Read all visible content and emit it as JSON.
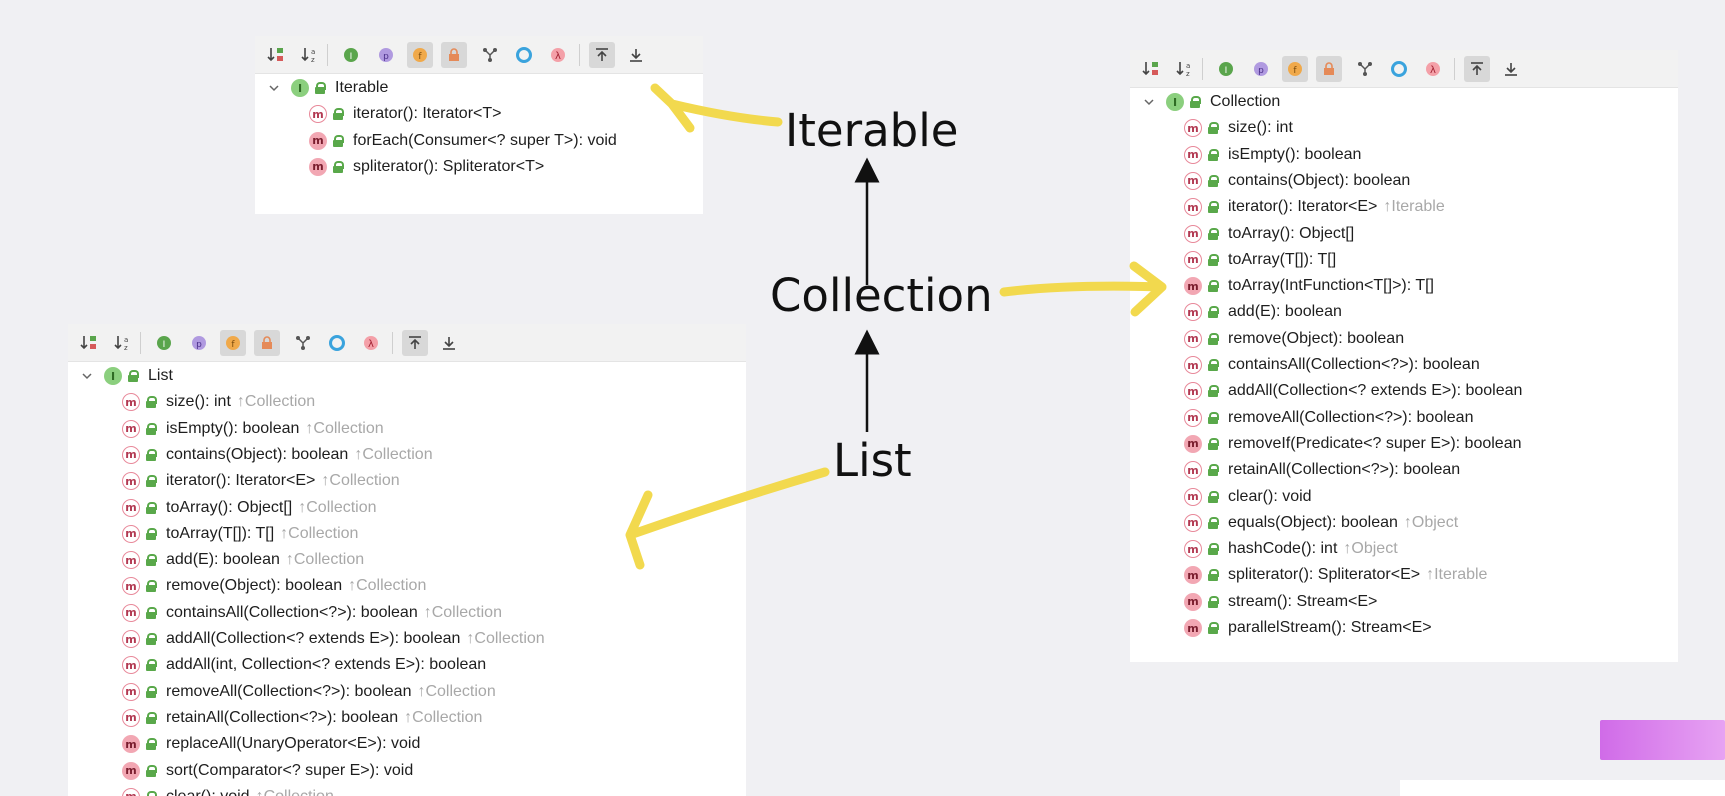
{
  "labels": {
    "iterable": "Iterable",
    "collection": "Collection",
    "list": "List"
  },
  "colors": {
    "highlighter": "#f2d94e",
    "interface_badge": "#8bcf7e",
    "method_badge": "#f2a7b3",
    "inherited_text": "#a8a8a8"
  },
  "toolbar_icons": [
    "sort-by-visibility-icon",
    "sort-alphabetically-icon",
    "show-inherited-icon",
    "show-properties-icon",
    "show-fields-icon",
    "show-non-public-icon",
    "show-anonymous-classes-icon",
    "show-lambdas-icon",
    "show-lambda-icon",
    "autoscroll-to-source-icon",
    "autoscroll-from-source-icon"
  ],
  "iterable_panel": {
    "root": "Iterable",
    "members": [
      {
        "text": "iterator(): Iterator<T>",
        "abstract": true,
        "inherited": ""
      },
      {
        "text": "forEach(Consumer<? super T>): void",
        "abstract": false,
        "inherited": ""
      },
      {
        "text": "spliterator(): Spliterator<T>",
        "abstract": false,
        "inherited": ""
      }
    ]
  },
  "collection_panel": {
    "root": "Collection",
    "members": [
      {
        "text": "size(): int",
        "abstract": true,
        "inherited": ""
      },
      {
        "text": "isEmpty(): boolean",
        "abstract": true,
        "inherited": ""
      },
      {
        "text": "contains(Object): boolean",
        "abstract": true,
        "inherited": ""
      },
      {
        "text": "iterator(): Iterator<E>",
        "abstract": true,
        "inherited": "↑Iterable"
      },
      {
        "text": "toArray(): Object[]",
        "abstract": true,
        "inherited": ""
      },
      {
        "text": "toArray(T[]): T[]",
        "abstract": true,
        "inherited": ""
      },
      {
        "text": "toArray(IntFunction<T[]>): T[]",
        "abstract": false,
        "inherited": ""
      },
      {
        "text": "add(E): boolean",
        "abstract": true,
        "inherited": ""
      },
      {
        "text": "remove(Object): boolean",
        "abstract": true,
        "inherited": ""
      },
      {
        "text": "containsAll(Collection<?>): boolean",
        "abstract": true,
        "inherited": ""
      },
      {
        "text": "addAll(Collection<? extends E>): boolean",
        "abstract": true,
        "inherited": ""
      },
      {
        "text": "removeAll(Collection<?>): boolean",
        "abstract": true,
        "inherited": ""
      },
      {
        "text": "removeIf(Predicate<? super E>): boolean",
        "abstract": false,
        "inherited": ""
      },
      {
        "text": "retainAll(Collection<?>): boolean",
        "abstract": true,
        "inherited": ""
      },
      {
        "text": "clear(): void",
        "abstract": true,
        "inherited": ""
      },
      {
        "text": "equals(Object): boolean",
        "abstract": true,
        "inherited": "↑Object"
      },
      {
        "text": "hashCode(): int",
        "abstract": true,
        "inherited": "↑Object"
      },
      {
        "text": "spliterator(): Spliterator<E>",
        "abstract": false,
        "inherited": "↑Iterable"
      },
      {
        "text": "stream(): Stream<E>",
        "abstract": false,
        "inherited": ""
      },
      {
        "text": "parallelStream(): Stream<E>",
        "abstract": false,
        "inherited": ""
      }
    ]
  },
  "list_panel": {
    "root": "List",
    "members": [
      {
        "text": "size(): int",
        "abstract": true,
        "inherited": "↑Collection"
      },
      {
        "text": "isEmpty(): boolean",
        "abstract": true,
        "inherited": "↑Collection"
      },
      {
        "text": "contains(Object): boolean",
        "abstract": true,
        "inherited": "↑Collection"
      },
      {
        "text": "iterator(): Iterator<E>",
        "abstract": true,
        "inherited": "↑Collection"
      },
      {
        "text": "toArray(): Object[]",
        "abstract": true,
        "inherited": "↑Collection"
      },
      {
        "text": "toArray(T[]): T[]",
        "abstract": true,
        "inherited": "↑Collection"
      },
      {
        "text": "add(E): boolean",
        "abstract": true,
        "inherited": "↑Collection"
      },
      {
        "text": "remove(Object): boolean",
        "abstract": true,
        "inherited": "↑Collection"
      },
      {
        "text": "containsAll(Collection<?>): boolean",
        "abstract": true,
        "inherited": "↑Collection"
      },
      {
        "text": "addAll(Collection<? extends E>): boolean",
        "abstract": true,
        "inherited": "↑Collection"
      },
      {
        "text": "addAll(int, Collection<? extends E>): boolean",
        "abstract": true,
        "inherited": ""
      },
      {
        "text": "removeAll(Collection<?>): boolean",
        "abstract": true,
        "inherited": "↑Collection"
      },
      {
        "text": "retainAll(Collection<?>): boolean",
        "abstract": true,
        "inherited": "↑Collection"
      },
      {
        "text": "replaceAll(UnaryOperator<E>): void",
        "abstract": false,
        "inherited": ""
      },
      {
        "text": "sort(Comparator<? super E>): void",
        "abstract": false,
        "inherited": ""
      },
      {
        "text": "clear(): void",
        "abstract": true,
        "inherited": "↑Collection"
      }
    ]
  }
}
